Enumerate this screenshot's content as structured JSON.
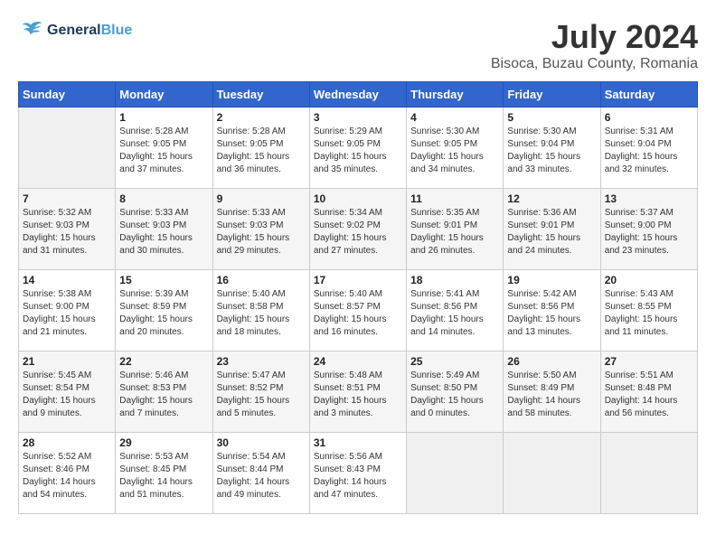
{
  "header": {
    "logo_line1": "General",
    "logo_line2": "Blue",
    "month_year": "July 2024",
    "location": "Bisoca, Buzau County, Romania"
  },
  "weekdays": [
    "Sunday",
    "Monday",
    "Tuesday",
    "Wednesday",
    "Thursday",
    "Friday",
    "Saturday"
  ],
  "weeks": [
    [
      {
        "day": "",
        "empty": true
      },
      {
        "day": "1",
        "sunrise": "5:28 AM",
        "sunset": "9:05 PM",
        "daylight": "15 hours and 37 minutes."
      },
      {
        "day": "2",
        "sunrise": "5:28 AM",
        "sunset": "9:05 PM",
        "daylight": "15 hours and 36 minutes."
      },
      {
        "day": "3",
        "sunrise": "5:29 AM",
        "sunset": "9:05 PM",
        "daylight": "15 hours and 35 minutes."
      },
      {
        "day": "4",
        "sunrise": "5:30 AM",
        "sunset": "9:05 PM",
        "daylight": "15 hours and 34 minutes."
      },
      {
        "day": "5",
        "sunrise": "5:30 AM",
        "sunset": "9:04 PM",
        "daylight": "15 hours and 33 minutes."
      },
      {
        "day": "6",
        "sunrise": "5:31 AM",
        "sunset": "9:04 PM",
        "daylight": "15 hours and 32 minutes."
      }
    ],
    [
      {
        "day": "7",
        "sunrise": "5:32 AM",
        "sunset": "9:03 PM",
        "daylight": "15 hours and 31 minutes."
      },
      {
        "day": "8",
        "sunrise": "5:33 AM",
        "sunset": "9:03 PM",
        "daylight": "15 hours and 30 minutes."
      },
      {
        "day": "9",
        "sunrise": "5:33 AM",
        "sunset": "9:03 PM",
        "daylight": "15 hours and 29 minutes."
      },
      {
        "day": "10",
        "sunrise": "5:34 AM",
        "sunset": "9:02 PM",
        "daylight": "15 hours and 27 minutes."
      },
      {
        "day": "11",
        "sunrise": "5:35 AM",
        "sunset": "9:01 PM",
        "daylight": "15 hours and 26 minutes."
      },
      {
        "day": "12",
        "sunrise": "5:36 AM",
        "sunset": "9:01 PM",
        "daylight": "15 hours and 24 minutes."
      },
      {
        "day": "13",
        "sunrise": "5:37 AM",
        "sunset": "9:00 PM",
        "daylight": "15 hours and 23 minutes."
      }
    ],
    [
      {
        "day": "14",
        "sunrise": "5:38 AM",
        "sunset": "9:00 PM",
        "daylight": "15 hours and 21 minutes."
      },
      {
        "day": "15",
        "sunrise": "5:39 AM",
        "sunset": "8:59 PM",
        "daylight": "15 hours and 20 minutes."
      },
      {
        "day": "16",
        "sunrise": "5:40 AM",
        "sunset": "8:58 PM",
        "daylight": "15 hours and 18 minutes."
      },
      {
        "day": "17",
        "sunrise": "5:40 AM",
        "sunset": "8:57 PM",
        "daylight": "15 hours and 16 minutes."
      },
      {
        "day": "18",
        "sunrise": "5:41 AM",
        "sunset": "8:56 PM",
        "daylight": "15 hours and 14 minutes."
      },
      {
        "day": "19",
        "sunrise": "5:42 AM",
        "sunset": "8:56 PM",
        "daylight": "15 hours and 13 minutes."
      },
      {
        "day": "20",
        "sunrise": "5:43 AM",
        "sunset": "8:55 PM",
        "daylight": "15 hours and 11 minutes."
      }
    ],
    [
      {
        "day": "21",
        "sunrise": "5:45 AM",
        "sunset": "8:54 PM",
        "daylight": "15 hours and 9 minutes."
      },
      {
        "day": "22",
        "sunrise": "5:46 AM",
        "sunset": "8:53 PM",
        "daylight": "15 hours and 7 minutes."
      },
      {
        "day": "23",
        "sunrise": "5:47 AM",
        "sunset": "8:52 PM",
        "daylight": "15 hours and 5 minutes."
      },
      {
        "day": "24",
        "sunrise": "5:48 AM",
        "sunset": "8:51 PM",
        "daylight": "15 hours and 3 minutes."
      },
      {
        "day": "25",
        "sunrise": "5:49 AM",
        "sunset": "8:50 PM",
        "daylight": "15 hours and 0 minutes."
      },
      {
        "day": "26",
        "sunrise": "5:50 AM",
        "sunset": "8:49 PM",
        "daylight": "14 hours and 58 minutes."
      },
      {
        "day": "27",
        "sunrise": "5:51 AM",
        "sunset": "8:48 PM",
        "daylight": "14 hours and 56 minutes."
      }
    ],
    [
      {
        "day": "28",
        "sunrise": "5:52 AM",
        "sunset": "8:46 PM",
        "daylight": "14 hours and 54 minutes."
      },
      {
        "day": "29",
        "sunrise": "5:53 AM",
        "sunset": "8:45 PM",
        "daylight": "14 hours and 51 minutes."
      },
      {
        "day": "30",
        "sunrise": "5:54 AM",
        "sunset": "8:44 PM",
        "daylight": "14 hours and 49 minutes."
      },
      {
        "day": "31",
        "sunrise": "5:56 AM",
        "sunset": "8:43 PM",
        "daylight": "14 hours and 47 minutes."
      },
      {
        "day": "",
        "empty": true
      },
      {
        "day": "",
        "empty": true
      },
      {
        "day": "",
        "empty": true
      }
    ]
  ]
}
